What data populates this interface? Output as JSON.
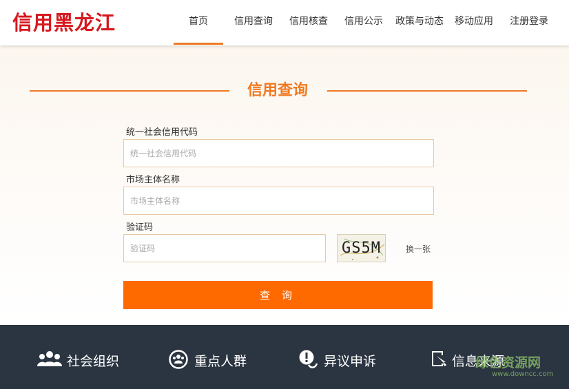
{
  "header": {
    "logo_text": "信用黑龙江",
    "nav": [
      {
        "label": "首页"
      },
      {
        "label": "信用查询"
      },
      {
        "label": "信用核查"
      },
      {
        "label": "信用公示"
      },
      {
        "label": "政策与动态"
      },
      {
        "label": "移动应用"
      },
      {
        "label": "注册登录"
      }
    ],
    "active_nav": "首页"
  },
  "main": {
    "section_title": "信用查询",
    "fields": {
      "credit_code": {
        "label": "统一社会信用代码",
        "placeholder": "统一社会信用代码",
        "value": ""
      },
      "entity_name": {
        "label": "市场主体名称",
        "placeholder": "市场主体名称",
        "value": ""
      },
      "captcha": {
        "label": "验证码",
        "placeholder": "验证码",
        "value": ""
      }
    },
    "captcha_text": "GS5M",
    "refresh_label": "换一张",
    "submit_label": "查 询"
  },
  "footer": {
    "items": [
      {
        "label": "社会组织",
        "icon": "group-icon"
      },
      {
        "label": "重点人群",
        "icon": "people-circle-icon"
      },
      {
        "label": "异议申诉",
        "icon": "feedback-icon"
      },
      {
        "label": "信息来源",
        "icon": "source-document-icon"
      }
    ]
  },
  "watermark": {
    "text": "绿色资源网",
    "url": "www.downcc.com"
  },
  "colors": {
    "brand_red": "#d6181f",
    "accent_orange": "#f07a22",
    "button_orange": "#ff6a00",
    "footer_bg": "#2b3541",
    "input_border": "#e8c9a6"
  }
}
